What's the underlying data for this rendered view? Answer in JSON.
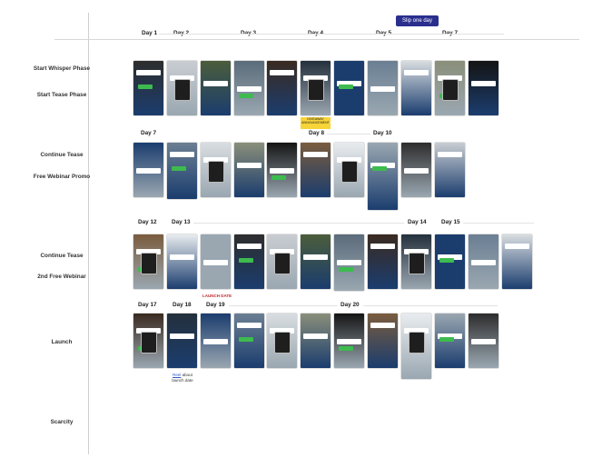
{
  "banner": {
    "slip_label": "Slip one day"
  },
  "header_days": [
    "Day 1",
    "Day 2",
    "Day 3",
    "Day 4",
    "Day 5",
    "Day 7"
  ],
  "phases": {
    "start_whisper": "Start Whisper Phase",
    "start_tease": "Start Tease Phase",
    "continue_tease": "Continue Tease",
    "free_webinar": "Free Webinar Promo",
    "continue_tease_2": "Continue Tease",
    "second_webinar": "2nd Free Webinar",
    "launch": "Launch",
    "scarcity": "Scarcity"
  },
  "row2_days": [
    "Day 7",
    "Day 8",
    "Day 10"
  ],
  "row3_days": [
    "Day 12",
    "Day 13",
    "Day 14",
    "Day 15"
  ],
  "row4_days": [
    "Day 17",
    "Day 18",
    "Day 19",
    "Day 20"
  ],
  "annotations": {
    "launch_date": "LAUNCH DATE",
    "reel_link": "Reel",
    "reel_note": "about launch date",
    "yellow_note": "GIVEAWAY ANNOUNCEMENT"
  },
  "colors": {
    "slip_banner": "#2a2f8e",
    "launch_date_text": "#c0282c",
    "yellow_note_bg": "#f7d437",
    "link": "#2b58c9"
  },
  "rows": [
    {
      "count": 11
    },
    {
      "count": 6
    },
    {
      "count": 12
    },
    {
      "count": 11
    }
  ]
}
